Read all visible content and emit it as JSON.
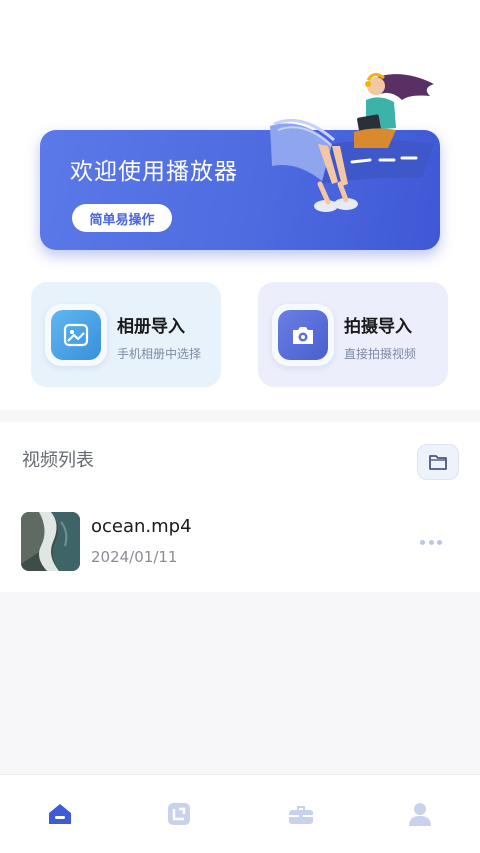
{
  "banner": {
    "title": "欢迎使用播放器",
    "button_label": "简单易操作",
    "accent_color": "#4e6be0"
  },
  "actions": [
    {
      "title": "相册导入",
      "subtitle": "手机相册中选择",
      "icon": "image-icon",
      "color": "#3a8fdc"
    },
    {
      "title": "拍摄导入",
      "subtitle": "直接拍摄视频",
      "icon": "camera-icon",
      "color": "#4a5fd0"
    }
  ],
  "video_list": {
    "title": "视频列表",
    "folder_icon": "folder-icon",
    "items": [
      {
        "name": "ocean.mp4",
        "date": "2024/01/11",
        "thumbnail": "ocean-thumbnail",
        "more_icon": "more-dots-icon"
      }
    ]
  },
  "bottom_nav": {
    "items": [
      {
        "icon": "home-icon",
        "active": true,
        "color": "#3f5bd6"
      },
      {
        "icon": "crop-icon",
        "active": false,
        "color": "#c8d2ec"
      },
      {
        "icon": "toolbox-icon",
        "active": false,
        "color": "#c8d2ec"
      },
      {
        "icon": "user-icon",
        "active": false,
        "color": "#c8d2ec"
      }
    ]
  }
}
